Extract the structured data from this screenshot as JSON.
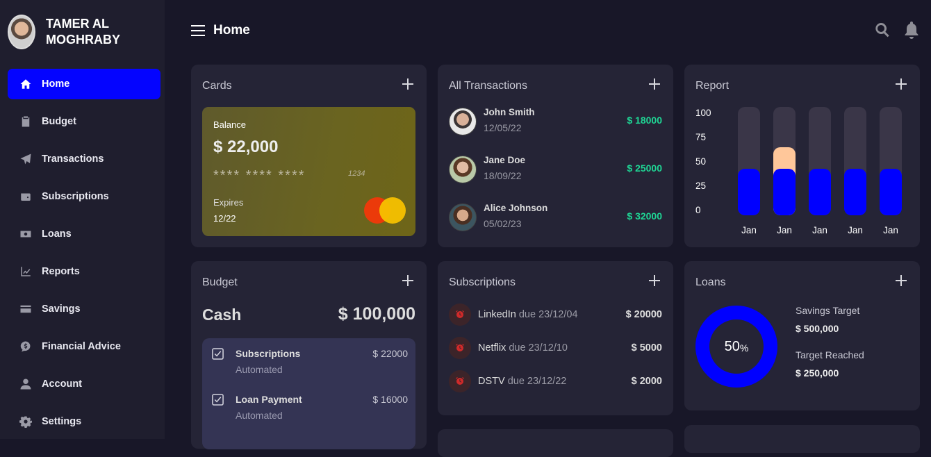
{
  "user": {
    "name": "TAMER AL MOGHRABY"
  },
  "sidebar": {
    "items": [
      {
        "label": "Home",
        "icon": "home-icon",
        "active": true
      },
      {
        "label": "Budget",
        "icon": "clipboard-icon"
      },
      {
        "label": "Transactions",
        "icon": "paper-plane-icon"
      },
      {
        "label": "Subscriptions",
        "icon": "wallet-icon"
      },
      {
        "label": "Loans",
        "icon": "money-bill-icon"
      },
      {
        "label": "Reports",
        "icon": "chart-line-icon"
      },
      {
        "label": "Savings",
        "icon": "credit-card-icon"
      },
      {
        "label": "Financial Advice",
        "icon": "dollar-comment-icon"
      },
      {
        "label": "Account",
        "icon": "user-icon"
      },
      {
        "label": "Settings",
        "icon": "gear-icon"
      }
    ]
  },
  "header": {
    "title": "Home"
  },
  "cards_widget": {
    "title": "Cards",
    "card": {
      "balance_label": "Balance",
      "balance": "$ 22,000",
      "masked": "**** **** ****",
      "last4": "1234",
      "expires_label": "Expires",
      "expires": "12/22"
    }
  },
  "transactions_widget": {
    "title": "All Transactions",
    "items": [
      {
        "name": "John Smith",
        "date": "12/05/22",
        "amount": "$ 18000"
      },
      {
        "name": "Jane Doe",
        "date": "18/09/22",
        "amount": "$ 25000"
      },
      {
        "name": "Alice Johnson",
        "date": "05/02/23",
        "amount": "$ 32000"
      }
    ]
  },
  "report_widget": {
    "title": "Report",
    "yticks": [
      "100",
      "75",
      "50",
      "25",
      "0"
    ]
  },
  "chart_data": {
    "type": "bar",
    "categories": [
      "Jan",
      "Jan",
      "Jan",
      "Jan",
      "Jan"
    ],
    "series": [
      {
        "values": [
          43,
          63,
          43,
          43,
          43
        ],
        "color": "#0000ff"
      }
    ],
    "highlight": {
      "index": 1,
      "color": "#ffc79a"
    },
    "ylim": [
      0,
      100
    ],
    "title": "Report"
  },
  "budget_widget": {
    "title": "Budget",
    "cash_label": "Cash",
    "cash_value": "$ 100,000",
    "items": [
      {
        "name": "Subscriptions",
        "status": "Automated",
        "amount": "$ 22000"
      },
      {
        "name": "Loan Payment",
        "status": "Automated",
        "amount": "$ 16000"
      }
    ]
  },
  "subscriptions_widget": {
    "title": "Subscriptions",
    "items": [
      {
        "name": "LinkedIn",
        "due": "due 23/12/04",
        "amount": "$ 20000"
      },
      {
        "name": "Netflix",
        "due": "due 23/12/10",
        "amount": "$ 5000"
      },
      {
        "name": "DSTV",
        "due": "due 23/12/22",
        "amount": "$ 2000"
      }
    ]
  },
  "loans_widget": {
    "title": "Loans",
    "percent": "50",
    "percent_sign": "%",
    "progress": 1.0,
    "savings_target_label": "Savings Target",
    "savings_target": "$ 500,000",
    "target_reached_label": "Target Reached",
    "target_reached": "$ 250,000"
  },
  "colors": {
    "accent": "#0404ff",
    "positive": "#1fd695",
    "bg": "#181728",
    "card": "#252436"
  }
}
